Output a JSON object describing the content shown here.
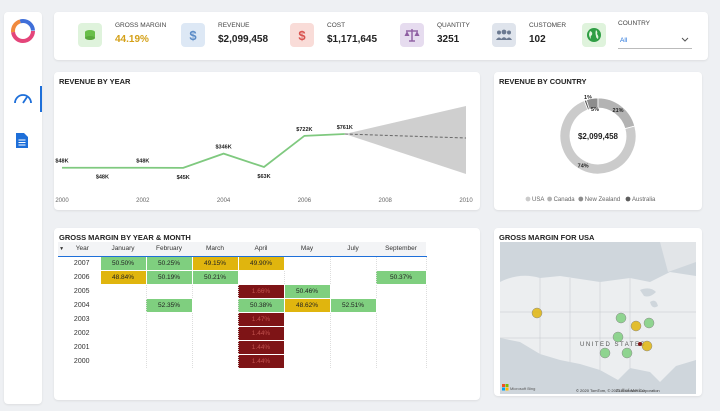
{
  "sidebar": {
    "logo": "app-logo",
    "items": [
      {
        "name": "dashboard-gauge-icon",
        "active": true
      },
      {
        "name": "document-icon",
        "active": false
      }
    ]
  },
  "kpis": [
    {
      "label": "GROSS MARGIN",
      "value": "44.19%",
      "icon": "coins-icon",
      "icon_bg": "#dff3dc",
      "icon_color": "#6abf4b",
      "value_color": "#d4a017"
    },
    {
      "label": "REVENUE",
      "value": "$2,099,458",
      "icon": "dollar-icon",
      "icon_bg": "#dde8f5",
      "icon_color": "#5b8cc7",
      "value_color": "#222222"
    },
    {
      "label": "COST",
      "value": "$1,171,645",
      "icon": "dollar-icon",
      "icon_bg": "#f9dcd8",
      "icon_color": "#d9534f",
      "value_color": "#222222"
    },
    {
      "label": "QUANTITY",
      "value": "3251",
      "icon": "scale-icon",
      "icon_bg": "#e6dcef",
      "icon_color": "#8e5ea2",
      "value_color": "#222222"
    },
    {
      "label": "CUSTOMER",
      "value": "102",
      "icon": "people-icon",
      "icon_bg": "#dfe4ec",
      "icon_color": "#6c7a91",
      "value_color": "#222222"
    }
  ],
  "country_filter": {
    "label": "COUNTRY",
    "selected": "All",
    "icon": "globe-icon"
  },
  "revenue_by_year": {
    "title": "REVENUE BY YEAR",
    "chart_data": {
      "type": "line",
      "x": [
        2000,
        2001,
        2002,
        2003,
        2004,
        2005,
        2006,
        2007
      ],
      "values": [
        48,
        48,
        48,
        45,
        346,
        63,
        722,
        761
      ],
      "labels": [
        "$48K",
        "$48K",
        "$48K",
        "$45K",
        "$346K",
        "$63K",
        "$722K",
        "$761K"
      ],
      "x_ticks": [
        "2000",
        "2002",
        "2004",
        "2006",
        "2008",
        "2010"
      ],
      "xlim": [
        2000,
        2010
      ],
      "forecast": {
        "from": 2007,
        "to": 2010,
        "shaded": true
      },
      "line_color": "#7fc97f"
    }
  },
  "revenue_by_country": {
    "title": "REVENUE BY COUNTRY",
    "chart_data": {
      "type": "pie",
      "center_label": "$2,099,458",
      "slices": [
        {
          "name": "USA",
          "value": 74,
          "label": "74%",
          "color": "#cbcbcb"
        },
        {
          "name": "Canada",
          "value": 21,
          "label": "21%",
          "color": "#b3b3b3"
        },
        {
          "name": "New Zealand",
          "value": 5,
          "label": "5%",
          "color": "#8d8d8d"
        },
        {
          "name": "Australia",
          "value": 1,
          "label": "1%",
          "color": "#5e5e5e"
        }
      ],
      "legend": [
        "USA",
        "Canada",
        "New Zealand",
        "Australia"
      ],
      "legend_position": "bottom"
    }
  },
  "gross_margin_table": {
    "title": "GROSS MARGIN BY YEAR & MONTH",
    "columns": [
      "Year",
      "January",
      "February",
      "March",
      "April",
      "May",
      "July",
      "September"
    ],
    "rows": [
      {
        "year": "2007",
        "cells": [
          [
            "50.50%",
            "green"
          ],
          [
            "50.25%",
            "green"
          ],
          [
            "49.15%",
            "yellow"
          ],
          [
            "49.90%",
            "yellow"
          ],
          [
            "",
            ""
          ],
          [
            "",
            ""
          ],
          [
            "",
            ""
          ]
        ]
      },
      {
        "year": "2006",
        "cells": [
          [
            "48.84%",
            "yellow"
          ],
          [
            "50.19%",
            "green"
          ],
          [
            "50.21%",
            "green"
          ],
          [
            "",
            ""
          ],
          [
            "",
            ""
          ],
          [
            "",
            ""
          ],
          [
            "50.37%",
            "green"
          ]
        ]
      },
      {
        "year": "2005",
        "cells": [
          [
            "",
            ""
          ],
          [
            "",
            ""
          ],
          [
            "",
            ""
          ],
          [
            "1.66%",
            "red"
          ],
          [
            "50.46%",
            "green"
          ],
          [
            "",
            ""
          ],
          [
            "",
            ""
          ]
        ]
      },
      {
        "year": "2004",
        "cells": [
          [
            "",
            ""
          ],
          [
            "52.35%",
            "green"
          ],
          [
            "",
            ""
          ],
          [
            "50.38%",
            "green"
          ],
          [
            "48.62%",
            "yellow"
          ],
          [
            "52.51%",
            "green"
          ],
          [
            "",
            ""
          ]
        ]
      },
      {
        "year": "2003",
        "cells": [
          [
            "",
            ""
          ],
          [
            "",
            ""
          ],
          [
            "",
            ""
          ],
          [
            "1.47%",
            "red"
          ],
          [
            "",
            ""
          ],
          [
            "",
            ""
          ],
          [
            "",
            ""
          ]
        ]
      },
      {
        "year": "2002",
        "cells": [
          [
            "",
            ""
          ],
          [
            "",
            ""
          ],
          [
            "",
            ""
          ],
          [
            "1.44%",
            "red"
          ],
          [
            "",
            ""
          ],
          [
            "",
            ""
          ],
          [
            "",
            ""
          ]
        ]
      },
      {
        "year": "2001",
        "cells": [
          [
            "",
            ""
          ],
          [
            "",
            ""
          ],
          [
            "",
            ""
          ],
          [
            "1.44%",
            "red"
          ],
          [
            "",
            ""
          ],
          [
            "",
            ""
          ],
          [
            "",
            ""
          ]
        ]
      },
      {
        "year": "2000",
        "cells": [
          [
            "",
            ""
          ],
          [
            "",
            ""
          ],
          [
            "",
            ""
          ],
          [
            "1.44%",
            "red"
          ],
          [
            "",
            ""
          ],
          [
            "",
            ""
          ],
          [
            "",
            ""
          ]
        ]
      }
    ]
  },
  "gross_margin_usa": {
    "title": "GROSS MARGIN FOR USA",
    "map_label": "UNITED STATES",
    "gulf_label": "Gulf of Mexico",
    "brand": "Microsoft Bing",
    "copyright": "© 2020 TomTom, © 2021 Microsoft Corporation"
  }
}
